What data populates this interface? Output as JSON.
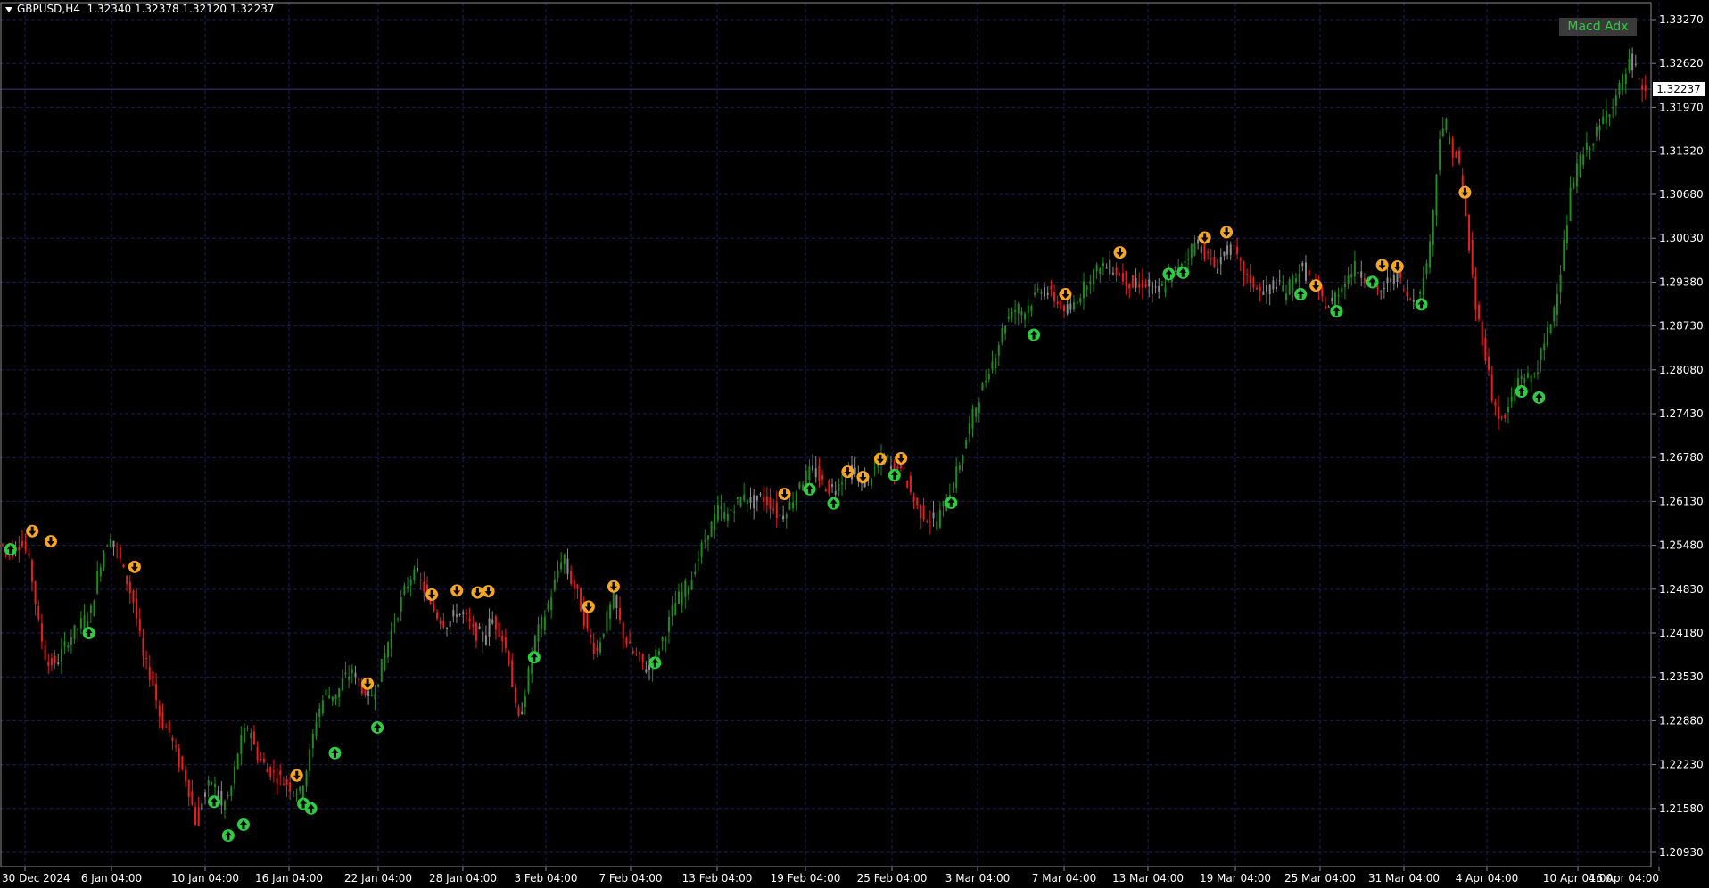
{
  "header": {
    "symbol": "GBPUSD,H4",
    "quote": "1.32340 1.32378 1.32120 1.32237"
  },
  "indicator_button": "Macd Adx",
  "current_price_label": "1.32237",
  "colors": {
    "background": "#000000",
    "grid": "#1c1c5a",
    "bull": "#1e8c1e",
    "bear": "#ee1c1c",
    "neutral": "#8c8c8c",
    "buy_arrow": "#2ecc40",
    "sell_arrow": "#f5a623",
    "axis_text": "#ffffff"
  },
  "chart_data": {
    "type": "candlestick",
    "symbol": "GBPUSD",
    "timeframe": "H4",
    "ylim": [
      1.206,
      1.336
    ],
    "y_ticks": [
      "1.33270",
      "1.32620",
      "1.31970",
      "1.31320",
      "1.30680",
      "1.30030",
      "1.29380",
      "1.28730",
      "1.28080",
      "1.27430",
      "1.26780",
      "1.26130",
      "1.25480",
      "1.24830",
      "1.24180",
      "1.23530",
      "1.22880",
      "1.22230",
      "1.21580",
      "1.20930"
    ],
    "x_ticks": [
      "30 Dec 2024",
      "6 Jan 04:00",
      "10 Jan 04:00",
      "16 Jan 04:00",
      "22 Jan 04:00",
      "28 Jan 04:00",
      "3 Feb 04:00",
      "7 Feb 04:00",
      "13 Feb 04:00",
      "19 Feb 04:00",
      "25 Feb 04:00",
      "3 Mar 04:00",
      "7 Mar 04:00",
      "13 Mar 04:00",
      "19 Mar 04:00",
      "25 Mar 04:00",
      "31 Mar 04:00",
      "4 Apr 04:00",
      "10 Apr 04:00",
      "16 Apr 04:00"
    ],
    "grid": true,
    "price_path": [
      [
        0,
        1.255
      ],
      [
        12,
        1.254
      ],
      [
        20,
        1.256
      ],
      [
        28,
        1.252
      ],
      [
        36,
        1.243
      ],
      [
        44,
        1.237
      ],
      [
        54,
        1.238
      ],
      [
        64,
        1.241
      ],
      [
        74,
        1.243
      ],
      [
        84,
        1.245
      ],
      [
        92,
        1.252
      ],
      [
        100,
        1.256
      ],
      [
        108,
        1.254
      ],
      [
        116,
        1.25
      ],
      [
        124,
        1.246
      ],
      [
        132,
        1.238
      ],
      [
        140,
        1.235
      ],
      [
        148,
        1.229
      ],
      [
        156,
        1.227
      ],
      [
        164,
        1.223
      ],
      [
        172,
        1.22
      ],
      [
        180,
        1.214
      ],
      [
        188,
        1.218
      ],
      [
        196,
        1.22
      ],
      [
        204,
        1.216
      ],
      [
        212,
        1.218
      ],
      [
        220,
        1.225
      ],
      [
        228,
        1.228
      ],
      [
        236,
        1.224
      ],
      [
        244,
        1.222
      ],
      [
        252,
        1.221
      ],
      [
        260,
        1.22
      ],
      [
        268,
        1.219
      ],
      [
        276,
        1.218
      ],
      [
        284,
        1.223
      ],
      [
        292,
        1.23
      ],
      [
        300,
        1.233
      ],
      [
        308,
        1.232
      ],
      [
        316,
        1.235
      ],
      [
        324,
        1.236
      ],
      [
        332,
        1.234
      ],
      [
        340,
        1.232
      ],
      [
        348,
        1.235
      ],
      [
        356,
        1.24
      ],
      [
        364,
        1.244
      ],
      [
        372,
        1.248
      ],
      [
        380,
        1.251
      ],
      [
        388,
        1.249
      ],
      [
        396,
        1.246
      ],
      [
        404,
        1.244
      ],
      [
        412,
        1.243
      ],
      [
        420,
        1.245
      ],
      [
        428,
        1.244
      ],
      [
        436,
        1.242
      ],
      [
        444,
        1.241
      ],
      [
        452,
        1.244
      ],
      [
        460,
        1.242
      ],
      [
        468,
        1.238
      ],
      [
        476,
        1.228
      ],
      [
        484,
        1.234
      ],
      [
        492,
        1.241
      ],
      [
        500,
        1.244
      ],
      [
        508,
        1.248
      ],
      [
        516,
        1.253
      ],
      [
        524,
        1.25
      ],
      [
        532,
        1.247
      ],
      [
        540,
        1.242
      ],
      [
        548,
        1.239
      ],
      [
        556,
        1.243
      ],
      [
        564,
        1.247
      ],
      [
        572,
        1.242
      ],
      [
        580,
        1.239
      ],
      [
        588,
        1.238
      ],
      [
        596,
        1.236
      ],
      [
        604,
        1.239
      ],
      [
        612,
        1.242
      ],
      [
        620,
        1.246
      ],
      [
        628,
        1.248
      ],
      [
        636,
        1.25
      ],
      [
        644,
        1.254
      ],
      [
        652,
        1.257
      ],
      [
        660,
        1.26
      ],
      [
        668,
        1.259
      ],
      [
        676,
        1.261
      ],
      [
        684,
        1.262
      ],
      [
        692,
        1.261
      ],
      [
        700,
        1.262
      ],
      [
        708,
        1.261
      ],
      [
        716,
        1.259
      ],
      [
        724,
        1.26
      ],
      [
        732,
        1.263
      ],
      [
        740,
        1.265
      ],
      [
        748,
        1.266
      ],
      [
        756,
        1.264
      ],
      [
        764,
        1.263
      ],
      [
        772,
        1.264
      ],
      [
        780,
        1.266
      ],
      [
        788,
        1.265
      ],
      [
        796,
        1.264
      ],
      [
        804,
        1.266
      ],
      [
        812,
        1.268
      ],
      [
        820,
        1.266
      ],
      [
        828,
        1.267
      ],
      [
        836,
        1.263
      ],
      [
        844,
        1.26
      ],
      [
        852,
        1.259
      ],
      [
        860,
        1.258
      ],
      [
        868,
        1.261
      ],
      [
        876,
        1.264
      ],
      [
        884,
        1.268
      ],
      [
        892,
        1.273
      ],
      [
        900,
        1.277
      ],
      [
        908,
        1.28
      ],
      [
        916,
        1.284
      ],
      [
        924,
        1.288
      ],
      [
        932,
        1.29
      ],
      [
        940,
        1.289
      ],
      [
        948,
        1.291
      ],
      [
        956,
        1.293
      ],
      [
        964,
        1.292
      ],
      [
        972,
        1.291
      ],
      [
        980,
        1.289
      ],
      [
        988,
        1.291
      ],
      [
        996,
        1.293
      ],
      [
        1004,
        1.295
      ],
      [
        1012,
        1.296
      ],
      [
        1020,
        1.296
      ],
      [
        1028,
        1.295
      ],
      [
        1036,
        1.294
      ],
      [
        1044,
        1.293
      ],
      [
        1052,
        1.294
      ],
      [
        1060,
        1.292
      ],
      [
        1068,
        1.293
      ],
      [
        1076,
        1.295
      ],
      [
        1084,
        1.296
      ],
      [
        1092,
        1.298
      ],
      [
        1100,
        1.3
      ],
      [
        1108,
        1.298
      ],
      [
        1116,
        1.296
      ],
      [
        1124,
        1.298
      ],
      [
        1132,
        1.299
      ],
      [
        1140,
        1.296
      ],
      [
        1148,
        1.294
      ],
      [
        1156,
        1.293
      ],
      [
        1164,
        1.292
      ],
      [
        1172,
        1.294
      ],
      [
        1180,
        1.292
      ],
      [
        1188,
        1.294
      ],
      [
        1196,
        1.296
      ],
      [
        1204,
        1.294
      ],
      [
        1212,
        1.292
      ],
      [
        1220,
        1.29
      ],
      [
        1228,
        1.292
      ],
      [
        1236,
        1.294
      ],
      [
        1244,
        1.296
      ],
      [
        1252,
        1.295
      ],
      [
        1260,
        1.294
      ],
      [
        1268,
        1.292
      ],
      [
        1276,
        1.294
      ],
      [
        1284,
        1.295
      ],
      [
        1292,
        1.292
      ],
      [
        1300,
        1.291
      ],
      [
        1308,
        1.294
      ],
      [
        1316,
        1.302
      ],
      [
        1324,
        1.318
      ],
      [
        1332,
        1.314
      ],
      [
        1340,
        1.312
      ],
      [
        1348,
        1.302
      ],
      [
        1356,
        1.29
      ],
      [
        1364,
        1.284
      ],
      [
        1372,
        1.276
      ],
      [
        1380,
        1.273
      ],
      [
        1388,
        1.276
      ],
      [
        1396,
        1.28
      ],
      [
        1404,
        1.279
      ],
      [
        1412,
        1.281
      ],
      [
        1420,
        1.285
      ],
      [
        1428,
        1.29
      ],
      [
        1436,
        1.298
      ],
      [
        1444,
        1.308
      ],
      [
        1452,
        1.312
      ],
      [
        1460,
        1.314
      ],
      [
        1468,
        1.316
      ],
      [
        1476,
        1.319
      ],
      [
        1484,
        1.321
      ],
      [
        1492,
        1.324
      ],
      [
        1500,
        1.327
      ],
      [
        1506,
        1.323
      ],
      [
        1510,
        1.3224
      ]
    ],
    "signals_buy": [
      [
        8,
        1.2542
      ],
      [
        80,
        1.2418
      ],
      [
        195,
        1.2168
      ],
      [
        208,
        1.2118
      ],
      [
        222,
        1.2134
      ],
      [
        277,
        1.2165
      ],
      [
        284,
        1.2158
      ],
      [
        306,
        1.224
      ],
      [
        345,
        1.2278
      ],
      [
        489,
        1.2382
      ],
      [
        600,
        1.2374
      ],
      [
        742,
        1.2631
      ],
      [
        764,
        1.261
      ],
      [
        820,
        1.2652
      ],
      [
        872,
        1.2611
      ],
      [
        948,
        1.286
      ],
      [
        1072,
        1.295
      ],
      [
        1085,
        1.2952
      ],
      [
        1193,
        1.292
      ],
      [
        1226,
        1.2895
      ],
      [
        1259,
        1.2938
      ],
      [
        1304,
        1.2905
      ],
      [
        1396,
        1.2776
      ],
      [
        1412,
        1.2767
      ]
    ],
    "signals_sell": [
      [
        28,
        1.2569
      ],
      [
        45,
        1.2554
      ],
      [
        122,
        1.2516
      ],
      [
        271,
        1.2207
      ],
      [
        336,
        1.2343
      ],
      [
        395,
        1.2475
      ],
      [
        418,
        1.2481
      ],
      [
        437,
        1.2478
      ],
      [
        447,
        1.248
      ],
      [
        539,
        1.2457
      ],
      [
        562,
        1.2487
      ],
      [
        719,
        1.2624
      ],
      [
        777,
        1.2657
      ],
      [
        791,
        1.2649
      ],
      [
        807,
        1.2676
      ],
      [
        826,
        1.2677
      ],
      [
        977,
        1.292
      ],
      [
        1027,
        1.2982
      ],
      [
        1105,
        1.3004
      ],
      [
        1125,
        1.3012
      ],
      [
        1207,
        1.2933
      ],
      [
        1268,
        1.2963
      ],
      [
        1282,
        1.2961
      ],
      [
        1344,
        1.3071
      ]
    ]
  }
}
